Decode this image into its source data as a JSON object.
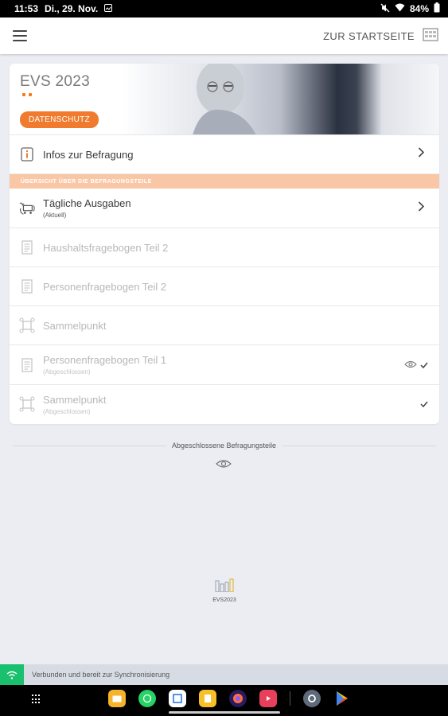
{
  "statusbar": {
    "time": "11:53",
    "date": "Di., 29. Nov.",
    "battery": "84%"
  },
  "appbar": {
    "home_link": "ZUR STARTSEITE"
  },
  "hero": {
    "title": "EVS 2023",
    "button": "DATENSCHUTZ"
  },
  "info_row": {
    "label": "Infos zur Befragung"
  },
  "section_header": "ÜBERSICHT ÜBER DIE BEFRAGUNGSTEILE",
  "items": [
    {
      "label": "Tägliche Ausgaben",
      "sub": "(Aktuell)",
      "icon": "shopping-cart-icon",
      "enabled": true
    },
    {
      "label": "Haushaltsfragebogen Teil 2",
      "sub": "",
      "icon": "questionnaire-icon",
      "enabled": false
    },
    {
      "label": "Personenfragebogen Teil 2",
      "sub": "",
      "icon": "questionnaire-icon",
      "enabled": false
    },
    {
      "label": "Sammelpunkt",
      "sub": "",
      "icon": "collection-point-icon",
      "enabled": false
    },
    {
      "label": "Personenfragebogen Teil 1",
      "sub": "(Abgeschlossen)",
      "icon": "questionnaire-icon",
      "enabled": false
    },
    {
      "label": "Sammelpunkt",
      "sub": "(Abgeschlossen)",
      "icon": "collection-point-icon",
      "enabled": false
    }
  ],
  "completed_label": "Abgeschlossene Befragungsteile",
  "logo_text": "EVS2023",
  "sync": {
    "text": "Verbunden und bereit zur Synchronisierung"
  },
  "colors": {
    "accent": "#f07a2e",
    "section_bg": "#f9c7a6",
    "sync_green": "#19c06d",
    "page_bg": "#ebedf3"
  }
}
